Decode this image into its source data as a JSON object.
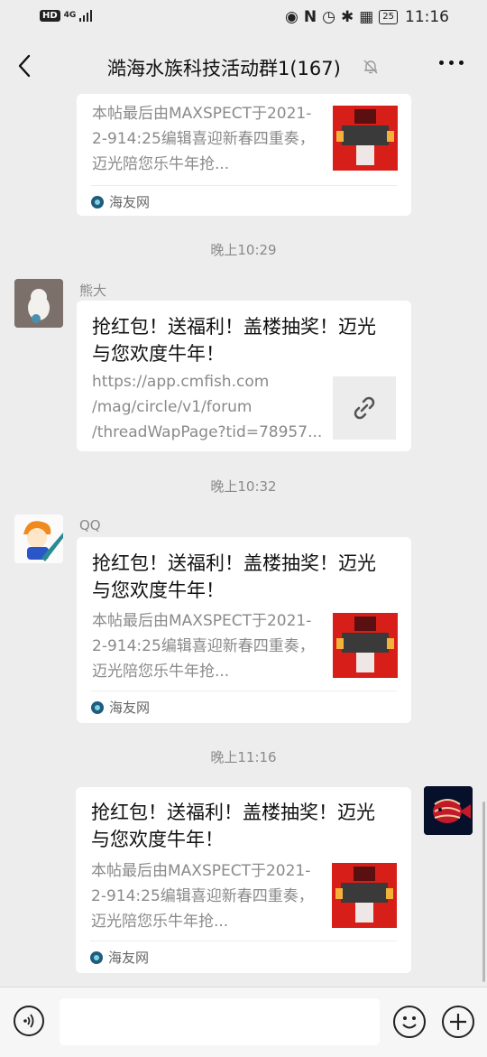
{
  "status_bar": {
    "hd": "HD",
    "network": "4G",
    "battery": "25",
    "time": "11:16"
  },
  "nav": {
    "title": "澔海水族科技活动群1(167)"
  },
  "colors": {
    "background": "#ededed",
    "card": "#ffffff",
    "thumb_red": "#d81e18",
    "muted_text": "#8a8a8a"
  },
  "messages": [
    {
      "type": "link_card",
      "desc": "本帖最后由MAXSPECT于2021-2-914:25编辑喜迎新春四重奏，迈光陪您乐牛年抢...",
      "source": "海友网",
      "thumb_icon": "poster-thumbnail"
    },
    {
      "type": "time",
      "text": "晚上10:29"
    },
    {
      "type": "link_card",
      "sender": "熊大",
      "avatar_icon": "avatar-cartoon-rabbit",
      "title": "抢红包！送福利！盖楼抽奖！迈光与您欢度牛年！",
      "desc_lines": [
        "https://app.cmfish.com",
        "/mag/circle/v1/forum",
        "/threadWapPage?tid=78957..."
      ],
      "thumb_icon": "link-icon"
    },
    {
      "type": "time",
      "text": "晚上10:32"
    },
    {
      "type": "link_card",
      "sender": "QQ",
      "avatar_icon": "avatar-cartoon-boy",
      "title": "抢红包！送福利！盖楼抽奖！迈光与您欢度牛年！",
      "desc": "本帖最后由MAXSPECT于2021-2-914:25编辑喜迎新春四重奏，迈光陪您乐牛年抢...",
      "source": "海友网",
      "thumb_icon": "poster-thumbnail"
    },
    {
      "type": "time",
      "text": "晚上11:16"
    },
    {
      "type": "link_card",
      "self": true,
      "avatar_icon": "avatar-fish",
      "title": "抢红包！送福利！盖楼抽奖！迈光与您欢度牛年！",
      "desc": "本帖最后由MAXSPECT于2021-2-914:25编辑喜迎新春四重奏，迈光陪您乐牛年抢...",
      "source": "海友网",
      "thumb_icon": "poster-thumbnail"
    }
  ],
  "input_bar": {
    "voice_icon": "voice-icon",
    "input_value": "",
    "emoji_icon": "emoji-icon",
    "plus_icon": "plus-icon"
  }
}
